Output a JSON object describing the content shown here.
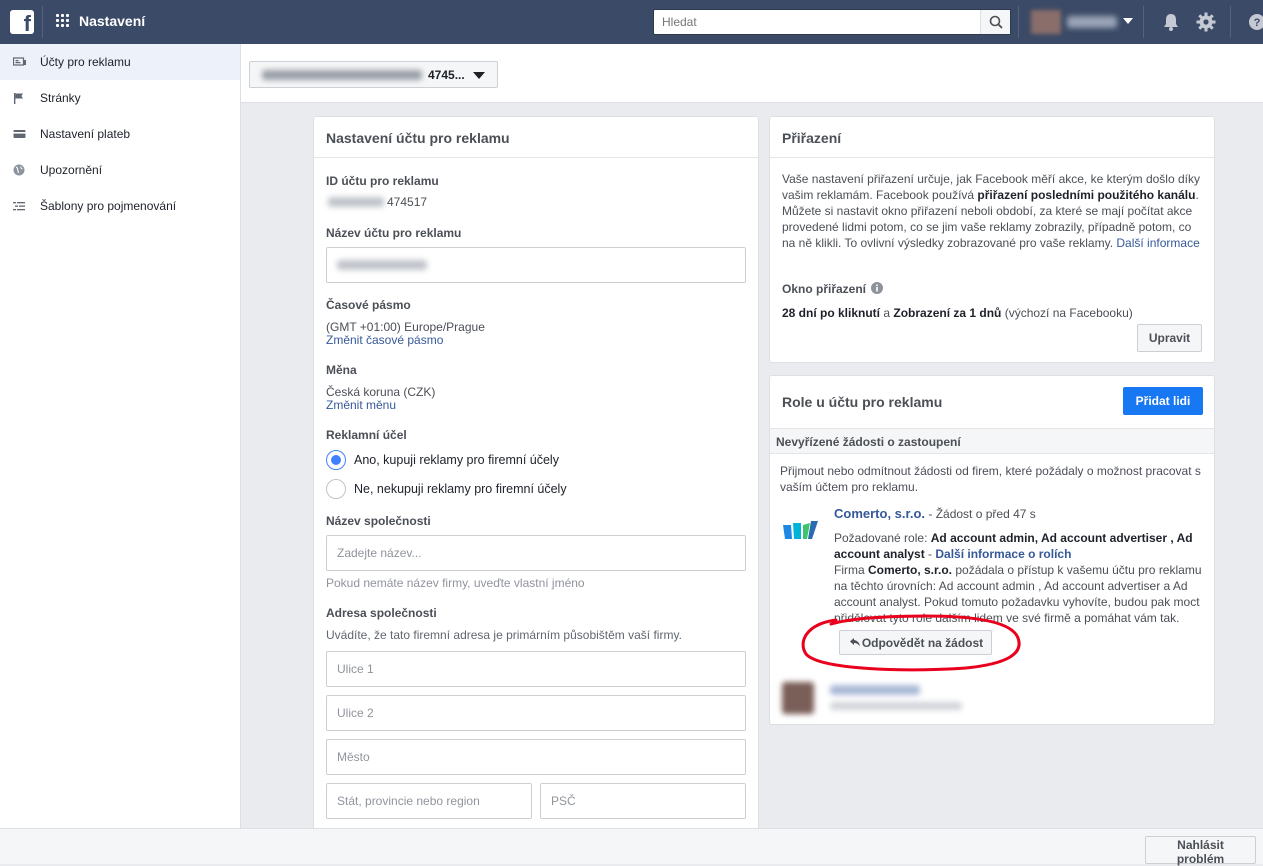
{
  "topbar": {
    "logo_letter": "f",
    "title": "Nastavení",
    "search_placeholder": "Hledat"
  },
  "sidebar": {
    "items": [
      {
        "label": "Účty pro reklamu",
        "icon": "ad-account-icon"
      },
      {
        "label": "Stránky",
        "icon": "flag-icon"
      },
      {
        "label": "Nastavení plateb",
        "icon": "credit-card-icon"
      },
      {
        "label": "Upozornění",
        "icon": "globe-icon"
      },
      {
        "label": "Šablony pro pojmenování",
        "icon": "naming-template-icon"
      }
    ]
  },
  "account_selector": {
    "visible_suffix": "4745..."
  },
  "settings_card": {
    "title": "Nastavení účtu pro reklamu",
    "account_id_label": "ID účtu pro reklamu",
    "account_id_suffix": "474517",
    "account_name_label": "Název účtu pro reklamu",
    "timezone_label": "Časové pásmo",
    "timezone_value": "(GMT +01:00) Europe/Prague",
    "timezone_link": "Změnit časové pásmo",
    "currency_label": "Měna",
    "currency_value": "Česká koruna (CZK)",
    "currency_link": "Změnit měnu",
    "purpose_label": "Reklamní účel",
    "purpose_yes": "Ano, kupuji reklamy pro firemní účely",
    "purpose_no": "Ne, nekupuji reklamy pro firemní účely",
    "company_name_label": "Název společnosti",
    "company_name_placeholder": "Zadejte název...",
    "company_name_hint": "Pokud nemáte název firmy, uveďte vlastní jméno",
    "address_label": "Adresa společnosti",
    "address_hint": "Uvádíte, že tato firemní adresa je primárním působištěm vaší firmy.",
    "street1_placeholder": "Ulice 1",
    "street2_placeholder": "Ulice 2",
    "city_placeholder": "Město",
    "state_placeholder": "Stát, provincie nebo region",
    "zip_placeholder": "PSČ"
  },
  "attribution_card": {
    "title": "Přiřazení",
    "desc_1": "Vaše nastavení přiřazení určuje, jak Facebook měří akce, ke kterým došlo díky vašim reklamám. Facebook používá ",
    "desc_bold": "přiřazení posledními použitého kanálu",
    "desc_2": ". Můžete si nastavit okno přiřazení neboli období, za které se mají počítat akce provedené lidmi potom, co se jim vaše reklamy zobrazily, případně potom, co na ně klikli. To ovlivní výsledky zobrazované pro vaše reklamy. ",
    "desc_link": "Další informace",
    "window_label": "Okno přiřazení",
    "window_value_1": "28 dní po kliknutí",
    "window_and": " a ",
    "window_value_2": "Zobrazení za 1 dnů",
    "window_default": " (výchozí na Facebooku)",
    "edit_button": "Upravit"
  },
  "roles_card": {
    "title": "Role u účtu pro reklamu",
    "add_people_button": "Přidat lidi",
    "pending_header": "Nevyřízené žádosti o zastoupení",
    "pending_desc": "Přijmout nebo odmítnout žádosti od firem, které požádaly o možnost pracovat s vaším účtem pro reklamu.",
    "request": {
      "company": "Comerto, s.r.o.",
      "time": " - Žádost o před 47 s",
      "roles_prefix": "Požadované role: ",
      "roles": "Ad account admin, Ad account advertiser , Ad account analyst",
      "roles_sep": " - ",
      "roles_link": "Další informace o rolích",
      "body_1": "Firma ",
      "body_company": "Comerto, s.r.o.",
      "body_2": " požádala o přístup k vašemu účtu pro reklamu na těchto úrovních: Ad account admin , Ad account advertiser a Ad account analyst. Pokud tomuto požadavku vyhovíte, budou pak moct přidělovat tyto role dalším lidem ve své firmě a pomáhat vám tak.",
      "respond_button": "Odpovědět na žádost"
    }
  },
  "footer": {
    "report_button": "Nahlásit problém"
  },
  "colors": {
    "topbar": "#3b4a66",
    "link": "#365899",
    "primary_button": "#1877f2",
    "radio_checked": "#4080ff",
    "annotation_circle": "#e8001c"
  }
}
